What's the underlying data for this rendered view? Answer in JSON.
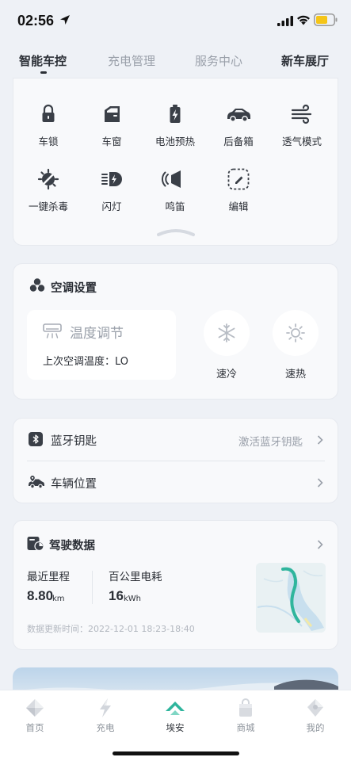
{
  "status_bar": {
    "time": "02:56"
  },
  "tabs": [
    {
      "label": "智能车控"
    },
    {
      "label": "充电管理"
    },
    {
      "label": "服务中心"
    },
    {
      "label": "新车展厅"
    }
  ],
  "controls": [
    {
      "label": "车锁",
      "icon": "lock-icon"
    },
    {
      "label": "车窗",
      "icon": "car-window-icon"
    },
    {
      "label": "电池预热",
      "icon": "battery-heat-icon"
    },
    {
      "label": "后备箱",
      "icon": "trunk-icon"
    },
    {
      "label": "透气模式",
      "icon": "ventilation-icon"
    },
    {
      "label": "一键杀毒",
      "icon": "sterilize-icon"
    },
    {
      "label": "闪灯",
      "icon": "flash-light-icon"
    },
    {
      "label": "鸣笛",
      "icon": "horn-icon"
    },
    {
      "label": "编辑",
      "icon": "edit-icon"
    }
  ],
  "ac": {
    "title": "空调设置",
    "temp_title": "温度调节",
    "last_temp": "上次空调温度：LO",
    "cool_label": "速冷",
    "heat_label": "速热"
  },
  "bluetooth": {
    "label": "蓝牙钥匙",
    "action": "激活蓝牙钥匙"
  },
  "location": {
    "label": "车辆位置"
  },
  "driving": {
    "title": "驾驶数据",
    "mileage_label": "最近里程",
    "mileage_value": "8.80",
    "mileage_unit": "km",
    "consumption_label": "百公里电耗",
    "consumption_value": "16",
    "consumption_unit": "kWh",
    "updated": "数据更新时间：2022-12-01 18:23-18:40"
  },
  "bottom_nav": [
    {
      "label": "首页"
    },
    {
      "label": "充电"
    },
    {
      "label": "埃安"
    },
    {
      "label": "商城"
    },
    {
      "label": "我的"
    }
  ],
  "colors": {
    "accent_teal": "#2fb59d",
    "battery_yellow": "#f5c518"
  }
}
